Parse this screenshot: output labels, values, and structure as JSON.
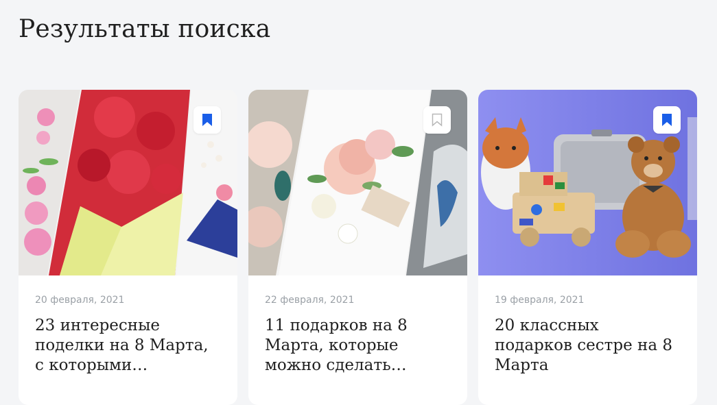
{
  "page": {
    "title": "Результаты поиска"
  },
  "colors": {
    "background": "#f4f5f7",
    "bookmark_active": "#1a5ee8",
    "bookmark_inactive": "#c4c4c4",
    "date": "#9aa0a6"
  },
  "cards": [
    {
      "date": "20 февраля, 2021",
      "title": "23 интересные поделки на 8 Марта, с которыми…",
      "bookmarked": true,
      "icon": "bookmark-filled-icon"
    },
    {
      "date": "22 февраля, 2021",
      "title": "11 подарков на 8 Марта, которые можно сделать…",
      "bookmarked": false,
      "icon": "bookmark-outline-icon"
    },
    {
      "date": "19 февраля, 2021",
      "title": "20 классных подарков сестре на 8 Марта",
      "bookmarked": true,
      "icon": "bookmark-filled-icon"
    }
  ]
}
